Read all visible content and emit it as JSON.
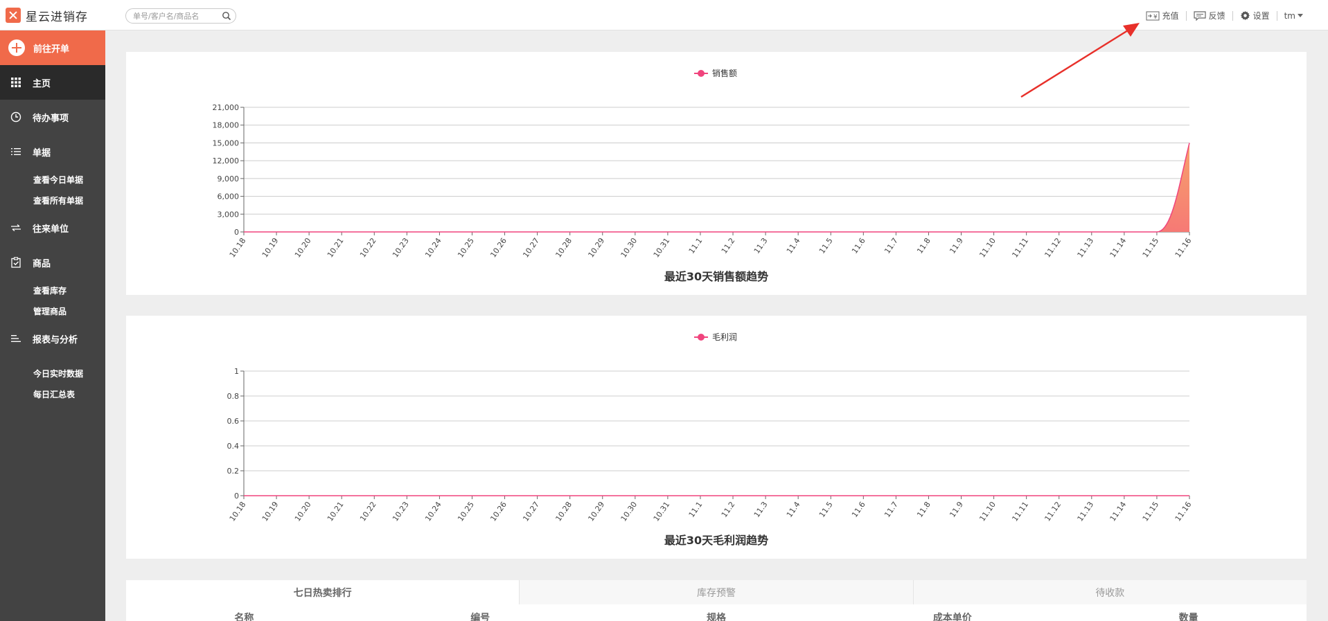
{
  "app": {
    "name": "星云进销存"
  },
  "search": {
    "placeholder": "单号/客户名/商品名"
  },
  "topnav": {
    "recharge": "充值",
    "feedback": "反馈",
    "settings": "设置",
    "user": "tm"
  },
  "sidebar": {
    "create_label": "前往开单",
    "home": "主页",
    "todo": "待办事项",
    "docs": "单据",
    "docs_today": "查看今日单据",
    "docs_all": "查看所有单据",
    "contacts": "往来单位",
    "goods": "商品",
    "goods_stock": "查看库存",
    "goods_manage": "管理商品",
    "reports": "报表与分析",
    "reports_realtime": "今日实时数据",
    "reports_daily": "每日汇总表"
  },
  "chart_data": [
    {
      "type": "area",
      "title": "最近30天销售额趋势",
      "legend": [
        "销售额"
      ],
      "x": [
        "10.18",
        "10.19",
        "10.20",
        "10.21",
        "10.22",
        "10.23",
        "10.24",
        "10.25",
        "10.26",
        "10.27",
        "10.28",
        "10.29",
        "10.30",
        "10.31",
        "11.1",
        "11.2",
        "11.3",
        "11.4",
        "11.5",
        "11.6",
        "11.7",
        "11.8",
        "11.9",
        "11.10",
        "11.11",
        "11.12",
        "11.13",
        "11.14",
        "11.15",
        "11.16"
      ],
      "series": [
        {
          "name": "销售额",
          "values": [
            0,
            0,
            0,
            0,
            0,
            0,
            0,
            0,
            0,
            0,
            0,
            0,
            0,
            0,
            0,
            0,
            0,
            0,
            0,
            0,
            0,
            0,
            0,
            0,
            0,
            0,
            0,
            0,
            0,
            15000
          ]
        }
      ],
      "ylim": [
        0,
        21000
      ],
      "yticks": [
        "0",
        "3,000",
        "6,000",
        "9,000",
        "12,000",
        "15,000",
        "18,000",
        "21,000"
      ],
      "yvals": [
        0,
        3000,
        6000,
        9000,
        12000,
        15000,
        18000,
        21000
      ],
      "grid": true,
      "legend_position": "top-center",
      "color": "#f0447d",
      "fill": "#f67c8e"
    },
    {
      "type": "line",
      "title": "最近30天毛利润趋势",
      "legend": [
        "毛利润"
      ],
      "x": [
        "10.18",
        "10.19",
        "10.20",
        "10.21",
        "10.22",
        "10.23",
        "10.24",
        "10.25",
        "10.26",
        "10.27",
        "10.28",
        "10.29",
        "10.30",
        "10.31",
        "11.1",
        "11.2",
        "11.3",
        "11.4",
        "11.5",
        "11.6",
        "11.7",
        "11.8",
        "11.9",
        "11.10",
        "11.11",
        "11.12",
        "11.13",
        "11.14",
        "11.15",
        "11.16"
      ],
      "series": [
        {
          "name": "毛利润",
          "values": [
            0,
            0,
            0,
            0,
            0,
            0,
            0,
            0,
            0,
            0,
            0,
            0,
            0,
            0,
            0,
            0,
            0,
            0,
            0,
            0,
            0,
            0,
            0,
            0,
            0,
            0,
            0,
            0,
            0,
            0
          ]
        }
      ],
      "ylim": [
        0,
        1
      ],
      "yticks": [
        "0",
        "0.2",
        "0.4",
        "0.6",
        "0.8",
        "1"
      ],
      "yvals": [
        0,
        0.2,
        0.4,
        0.6,
        0.8,
        1
      ],
      "grid": true,
      "legend_position": "top-center",
      "color": "#f0447d"
    }
  ],
  "tabs": [
    "七日热卖排行",
    "库存预警",
    "待收款"
  ],
  "table": {
    "columns": [
      "名称",
      "编号",
      "规格",
      "成本单价",
      "数量"
    ]
  },
  "colors": {
    "accent": "#f06a4a",
    "sidebar": "#434343",
    "sidebar_active": "#2a2a2a",
    "annotation": "#e8302a"
  }
}
